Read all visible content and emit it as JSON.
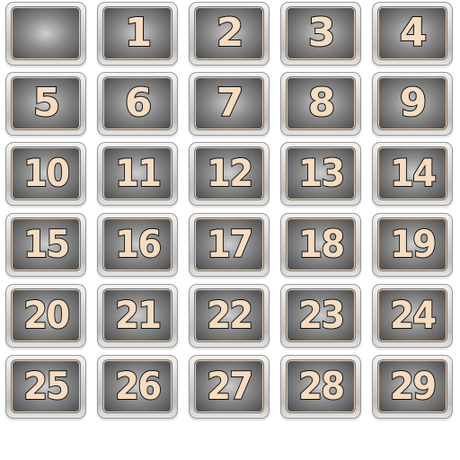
{
  "tiles": [
    "",
    "1",
    "2",
    "3",
    "4",
    "5",
    "6",
    "7",
    "8",
    "9",
    "10",
    "11",
    "12",
    "13",
    "14",
    "15",
    "16",
    "17",
    "18",
    "19",
    "20",
    "21",
    "22",
    "23",
    "24",
    "25",
    "26",
    "27",
    "28",
    "29"
  ],
  "colors": {
    "digit_fill": "#f6dcc0",
    "digit_outline": "#111111",
    "frame": "#d6d6d6",
    "panel": "#4a4a4a"
  }
}
